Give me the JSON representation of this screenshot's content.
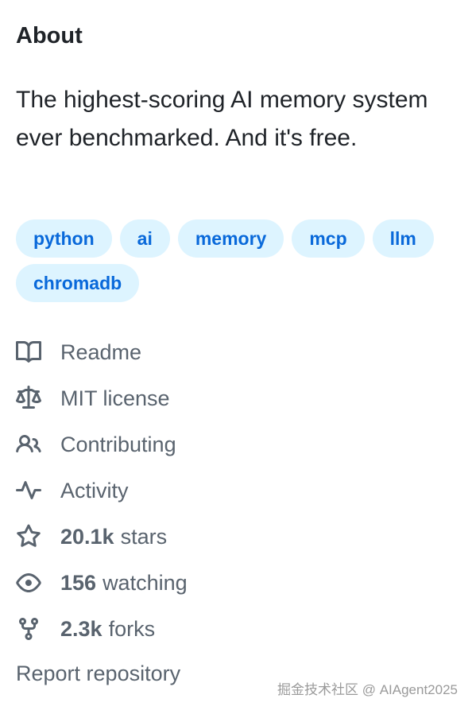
{
  "about": {
    "title": "About",
    "description": "The highest-scoring AI memory system ever benchmarked. And it's free."
  },
  "topics": [
    "python",
    "ai",
    "memory",
    "mcp",
    "llm",
    "chromadb"
  ],
  "meta": {
    "readme": "Readme",
    "license": "MIT license",
    "contributing": "Contributing",
    "activity": "Activity",
    "stars_count": "20.1k",
    "stars_label": "stars",
    "watching_count": "156",
    "watching_label": "watching",
    "forks_count": "2.3k",
    "forks_label": "forks"
  },
  "report": "Report repository",
  "watermark": "掘金技术社区 @ AIAgent2025",
  "colors": {
    "topic_bg": "#ddf4ff",
    "topic_text": "#0969da",
    "muted_text": "#59636e",
    "heading_text": "#1f2328"
  }
}
